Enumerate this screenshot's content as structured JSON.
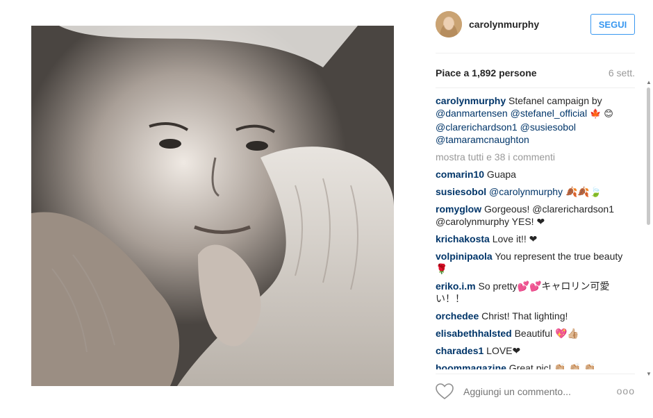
{
  "post": {
    "username": "carolynmurphy",
    "follow_label": "SEGUI",
    "likes": "Piace a 1,892 persone",
    "time_ago": "6 sett.",
    "caption_user": "carolynmurphy",
    "caption_text": " Stefanel campaign by",
    "caption_mentions": [
      "@danmartensen",
      "@stefanel_official",
      "@clarerichardson1",
      "@susiesobol",
      "@tamaramcnaughton"
    ],
    "caption_emoji": "🍁 😊",
    "show_all": "mostra tutti e 38 i commenti",
    "add_comment_placeholder": "Aggiungi un commento...",
    "more_label": "ooo"
  },
  "comments": [
    {
      "user": "comarin10",
      "mention": "",
      "text": " Guapa"
    },
    {
      "user": "susiesobol",
      "mention": " @carolynmurphy",
      "text": " 🍂🍂🍃"
    },
    {
      "user": "romyglow",
      "mention": "",
      "text": " Gorgeous! @clarerichardson1 @carolynmurphy YES! ❤"
    },
    {
      "user": "krichakosta",
      "mention": "",
      "text": " Love it!! ❤"
    },
    {
      "user": "volpinipaola",
      "mention": "",
      "text": " You represent the true beauty 🌹"
    },
    {
      "user": "eriko.i.m",
      "mention": "",
      "text": " So pretty💕💕キャロリン可愛い！！"
    },
    {
      "user": "orchedee",
      "mention": "",
      "text": " Christ! That lighting!"
    },
    {
      "user": "elisabethhalsted",
      "mention": "",
      "text": " Beautiful 💖👍🏼"
    },
    {
      "user": "charades1",
      "mention": "",
      "text": " LOVE❤"
    },
    {
      "user": "hoommagazine",
      "mention": "",
      "text": " Great pic! 👏🏼 👏🏼 👏🏼"
    }
  ],
  "icons": {
    "heart": "heart-icon",
    "more": "more-options-icon"
  }
}
